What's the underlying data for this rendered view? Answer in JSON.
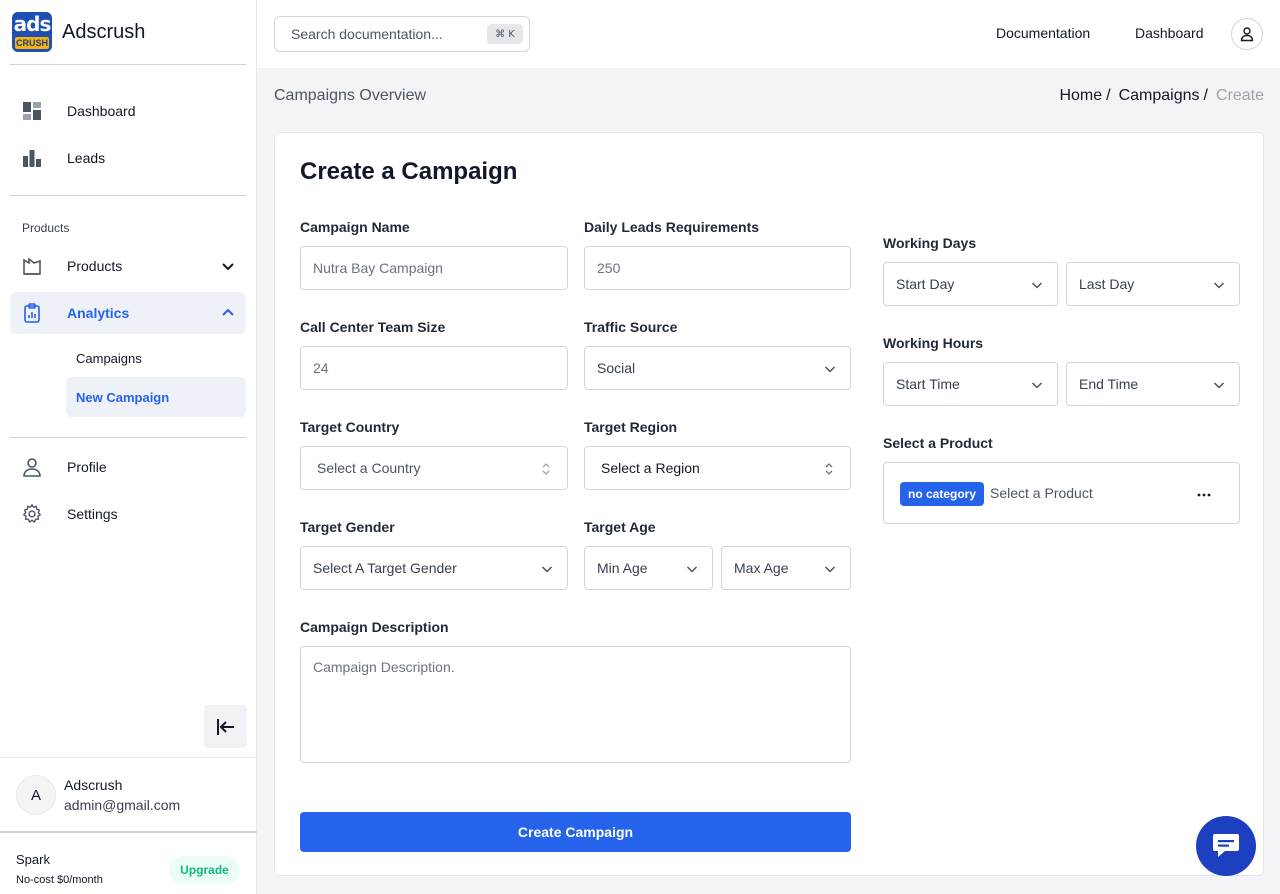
{
  "brand": {
    "name": "Adscrush",
    "logo_top": "ads",
    "logo_bottom": "CRUSH"
  },
  "sidebar": {
    "items": [
      {
        "label": "Dashboard",
        "icon": "dashboard-icon"
      },
      {
        "label": "Leads",
        "icon": "bar-chart-icon"
      }
    ],
    "section_label": "Products",
    "products_label": "Products",
    "analytics_label": "Analytics",
    "sub_items": [
      {
        "label": "Campaigns"
      },
      {
        "label": "New Campaign"
      }
    ],
    "profile_label": "Profile",
    "settings_label": "Settings"
  },
  "user": {
    "initial": "A",
    "name": "Adscrush",
    "email": "admin@gmail.com"
  },
  "plan": {
    "name": "Spark",
    "price": "No-cost $0/month",
    "upgrade_label": "Upgrade"
  },
  "topbar": {
    "search_placeholder": "Search documentation...",
    "shortcut": "⌘ K",
    "links": [
      "Documentation",
      "Dashboard"
    ]
  },
  "page": {
    "heading": "Campaigns Overview",
    "breadcrumb": [
      "Home",
      "Campaigns",
      "Create"
    ]
  },
  "form": {
    "title": "Create a Campaign",
    "campaign_name": {
      "label": "Campaign Name",
      "placeholder": "Nutra Bay Campaign"
    },
    "daily_leads": {
      "label": "Daily Leads Requirements",
      "placeholder": "250"
    },
    "team_size": {
      "label": "Call Center Team Size",
      "placeholder": "24"
    },
    "traffic_source": {
      "label": "Traffic Source",
      "value": "Social"
    },
    "target_country": {
      "label": "Target Country",
      "value": "Select a Country"
    },
    "target_region": {
      "label": "Target Region",
      "value": "Select a Region"
    },
    "target_gender": {
      "label": "Target Gender",
      "value": "Select A Target Gender"
    },
    "target_age": {
      "label": "Target Age",
      "min": "Min Age",
      "max": "Max Age"
    },
    "description": {
      "label": "Campaign Description",
      "placeholder": "Campaign Description."
    },
    "working_days": {
      "label": "Working Days",
      "start": "Start Day",
      "end": "Last Day"
    },
    "working_hours": {
      "label": "Working Hours",
      "start": "Start Time",
      "end": "End Time"
    },
    "product": {
      "label": "Select a Product",
      "badge": "no category",
      "placeholder": "Select a Product"
    },
    "submit_label": "Create Campaign"
  },
  "colors": {
    "primary": "#2563eb",
    "chat": "#1d40c0",
    "upgrade": "#10b981"
  }
}
